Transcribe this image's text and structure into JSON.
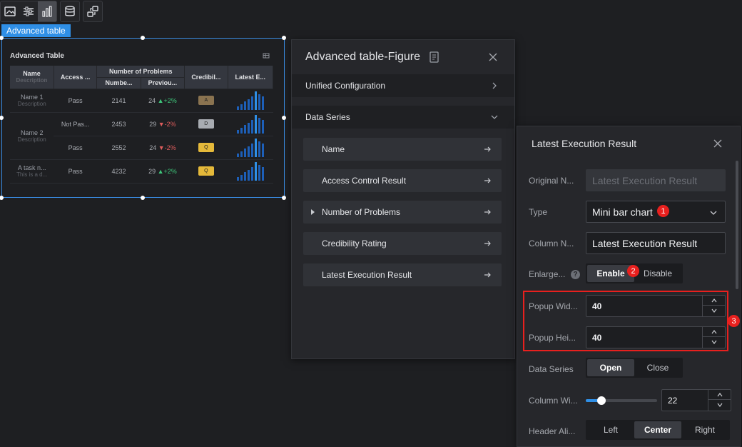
{
  "toolbar": {
    "buttons": [
      {
        "icon": "image-icon"
      },
      {
        "icon": "sliders-icon"
      },
      {
        "icon": "bar-chart-icon",
        "active": true
      },
      {
        "icon": "database-icon"
      },
      {
        "icon": "interaction-icon"
      }
    ]
  },
  "component": {
    "tag": "Advanced table",
    "title": "Advanced Table",
    "table": {
      "headers": {
        "name": "Name",
        "name_desc": "Description",
        "access": "Access ...",
        "problems": "Number of Problems",
        "problems_num": "Numbe...",
        "problems_prev": "Previou...",
        "credibility": "Credibil...",
        "latest": "Latest E..."
      },
      "rows": [
        {
          "name": "Name 1",
          "desc": "Description",
          "access": "Pass",
          "num": "2141",
          "prev": "24",
          "chg": "+2%",
          "dir": "up",
          "cred": "A",
          "cred_style": "bronze",
          "bars": [
            4,
            7,
            10,
            13,
            16,
            22,
            19,
            16
          ]
        },
        {
          "name": "Name 2",
          "desc": "Description",
          "access": "Not Pas...",
          "num": "2453",
          "prev": "29",
          "chg": "-2%",
          "dir": "down",
          "cred": "D",
          "cred_style": "silver",
          "bars": [
            4,
            7,
            10,
            13,
            16,
            22,
            19,
            16
          ]
        },
        {
          "name": "",
          "desc": "",
          "access": "Pass",
          "num": "2552",
          "prev": "24",
          "chg": "-2%",
          "dir": "down",
          "cred": "Q",
          "cred_style": "gold",
          "bars": [
            4,
            7,
            10,
            13,
            16,
            22,
            19,
            16
          ]
        },
        {
          "name": "A task n...",
          "desc": "This is a d...",
          "access": "Pass",
          "num": "4232",
          "prev": "29",
          "chg": "+2%",
          "dir": "up",
          "cred": "Q",
          "cred_style": "gold",
          "bars": [
            4,
            7,
            10,
            13,
            16,
            22,
            19,
            16
          ]
        }
      ]
    }
  },
  "figure_panel": {
    "title": "Advanced table-Figure",
    "sections": {
      "unified": "Unified Configuration",
      "data_series": "Data Series"
    },
    "items": [
      {
        "label": "Name",
        "expandable": false
      },
      {
        "label": "Access Control Result",
        "expandable": false
      },
      {
        "label": "Number of Problems",
        "expandable": true
      },
      {
        "label": "Credibility Rating",
        "expandable": false
      },
      {
        "label": "Latest Execution Result",
        "expandable": false
      }
    ]
  },
  "ler_panel": {
    "title": "Latest Execution Result",
    "original_name_label": "Original N...",
    "original_name_value": "Latest Execution Result",
    "type_label": "Type",
    "type_value": "Mini bar chart",
    "column_name_label": "Column N...",
    "column_name_value": "Latest Execution Result",
    "enlarge_label": "Enlarge...",
    "enlarge_options": [
      "Enable",
      "Disable"
    ],
    "enlarge_selected": "Enable",
    "popup_width_label": "Popup Wid...",
    "popup_width_value": "40",
    "popup_height_label": "Popup Hei...",
    "popup_height_value": "40",
    "data_series_label": "Data Series",
    "data_series_options": [
      "Open",
      "Close"
    ],
    "data_series_selected": "Open",
    "column_width_label": "Column Wi...",
    "column_width_value": "22",
    "column_width_fraction": 0.22,
    "header_align_label": "Header Ali...",
    "header_align_options": [
      "Left",
      "Center",
      "Right"
    ],
    "header_align_selected": "Center"
  },
  "annotations": {
    "badge1": "1",
    "badge2": "2",
    "badge3": "3",
    "color": "#e8201e"
  },
  "colors": {
    "accent": "#2f8fe6",
    "background": "#1e1f22",
    "panel": "#26272b",
    "up": "#3ec67a",
    "down": "#e05d5d"
  }
}
